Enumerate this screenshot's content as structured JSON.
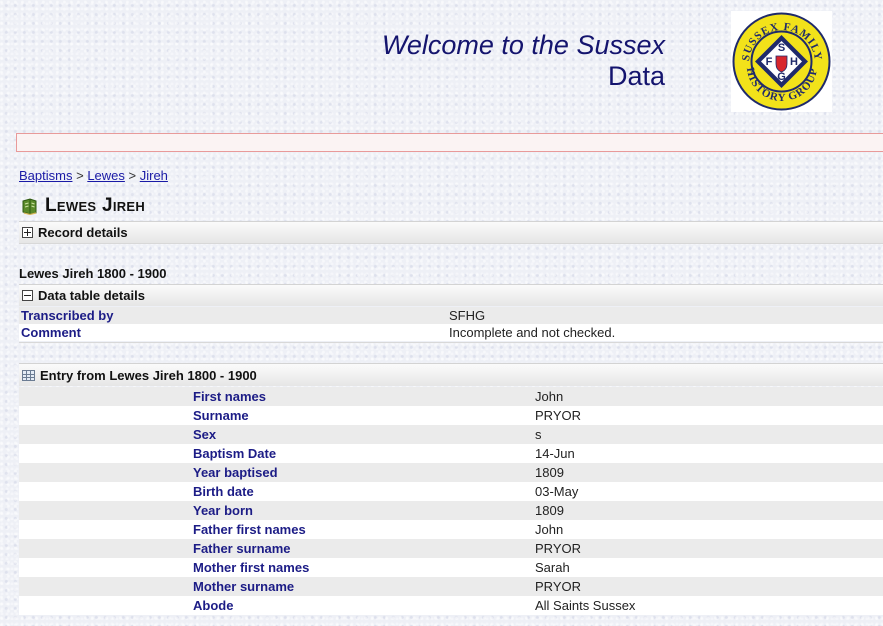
{
  "header": {
    "welcome_line1": "Welcome to the Sussex",
    "welcome_line2": "Data",
    "logo_text_top": "SUSSEX FAMILY",
    "logo_text_bottom": "HISTORY GROUP",
    "logo_letters": [
      "S",
      "F",
      "H",
      "G"
    ]
  },
  "breadcrumb": {
    "items": [
      "Baptisms",
      "Lewes",
      "Jireh"
    ],
    "separator": ">"
  },
  "page_title": "Lewes Jireh",
  "record_details": {
    "label": "Record details"
  },
  "subtitle": "Lewes Jireh 1800 - 1900",
  "data_table_details": {
    "label": "Data table details",
    "rows": [
      {
        "label": "Transcribed by",
        "value": "SFHG"
      },
      {
        "label": "Comment",
        "value": "Incomplete and not checked."
      }
    ]
  },
  "entry": {
    "label": "Entry from Lewes Jireh 1800 - 1900",
    "rows": [
      {
        "label": "First names",
        "value": "John"
      },
      {
        "label": "Surname",
        "value": "PRYOR"
      },
      {
        "label": "Sex",
        "value": "s"
      },
      {
        "label": "Baptism Date",
        "value": "14-Jun"
      },
      {
        "label": "Year baptised",
        "value": "1809"
      },
      {
        "label": "Birth date",
        "value": "03-May"
      },
      {
        "label": "Year born",
        "value": "1809"
      },
      {
        "label": "Father first names",
        "value": "John"
      },
      {
        "label": "Father surname",
        "value": "PRYOR"
      },
      {
        "label": "Mother first names",
        "value": "Sarah"
      },
      {
        "label": "Mother surname",
        "value": "PRYOR"
      },
      {
        "label": "Abode",
        "value": "All Saints Sussex"
      }
    ]
  },
  "colors": {
    "heading_blue": "#14146e",
    "label_blue": "#1c1c86",
    "logo_yellow": "#f2e21a",
    "logo_navy": "#1f2a6b",
    "logo_red": "#d8262c"
  }
}
